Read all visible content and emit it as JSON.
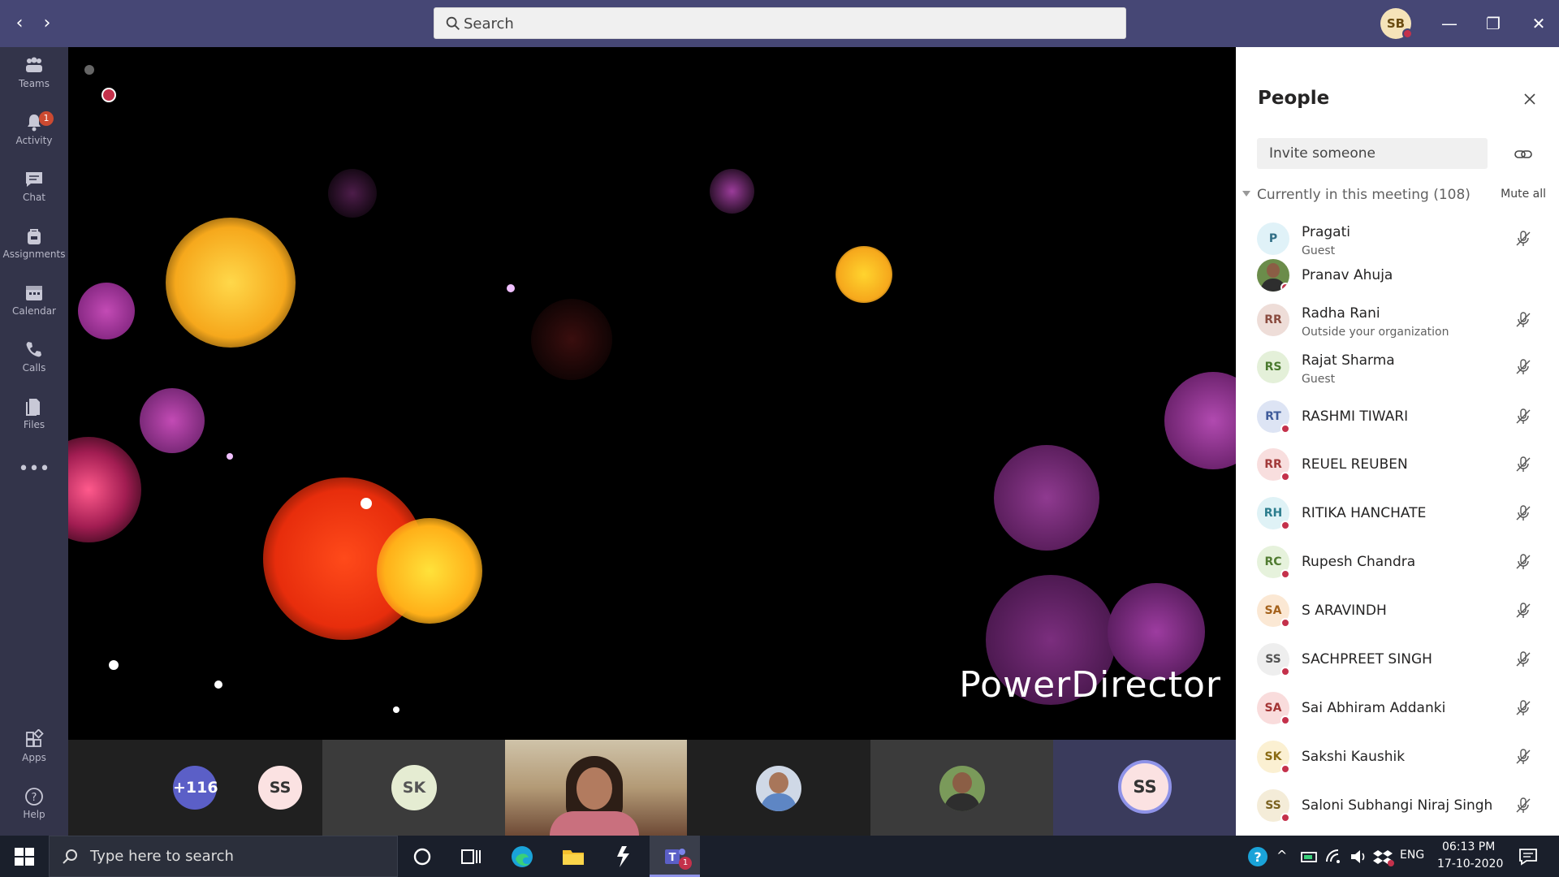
{
  "topbar": {
    "back_icon": "chevron-left-icon",
    "forward_icon": "chevron-right-icon",
    "search_placeholder": "Search",
    "user_initials": "SB",
    "minimize": "—",
    "maximize": "❐",
    "close": "✕"
  },
  "rail": {
    "items": [
      {
        "label": "Teams",
        "icon": "teams-icon"
      },
      {
        "label": "Activity",
        "icon": "bell-icon",
        "badge": "1"
      },
      {
        "label": "Chat",
        "icon": "chat-icon"
      },
      {
        "label": "Assignments",
        "icon": "backpack-icon"
      },
      {
        "label": "Calendar",
        "icon": "calendar-icon"
      },
      {
        "label": "Calls",
        "icon": "phone-icon"
      },
      {
        "label": "Files",
        "icon": "files-icon"
      },
      {
        "label": "•••",
        "icon": "more-icon"
      },
      {
        "label": "Apps",
        "icon": "apps-icon"
      },
      {
        "label": "Help",
        "icon": "help-icon"
      }
    ]
  },
  "stage": {
    "watermark": "PowerDirector",
    "recording_indicator": "recording-icon"
  },
  "gallery": {
    "overflow_count": "+116",
    "tiles": [
      {
        "initials": "SS"
      },
      {
        "initials": "SK"
      },
      {
        "initials": ""
      },
      {
        "initials": ""
      },
      {
        "initials": ""
      },
      {
        "initials": "SS"
      }
    ]
  },
  "panel": {
    "title": "People",
    "invite_placeholder": "Invite someone",
    "section_label": "Currently in this meeting (108)",
    "mute_all": "Mute all",
    "people": [
      {
        "initials": "P",
        "name": "Pragati",
        "sub": "Guest",
        "color": "#e0f2f8",
        "fg": "#2f6d85",
        "status": false,
        "mic": true
      },
      {
        "initials": "",
        "name": "Pranav Ahuja",
        "sub": "",
        "color": "#6b8c4a",
        "fg": "#fff",
        "status": true,
        "mic": false
      },
      {
        "initials": "RR",
        "name": "Radha Rani",
        "sub": "Outside your organization",
        "color": "#eeddd8",
        "fg": "#8a4b3f",
        "status": false,
        "mic": true
      },
      {
        "initials": "RS",
        "name": "Rajat Sharma",
        "sub": "Guest",
        "color": "#e4f0d9",
        "fg": "#4a7a2e",
        "status": false,
        "mic": true
      },
      {
        "initials": "RT",
        "name": "RASHMI TIWARI",
        "sub": "",
        "color": "#dde4f4",
        "fg": "#3f5b9a",
        "status": true,
        "mic": true
      },
      {
        "initials": "RR",
        "name": "REUEL REUBEN",
        "sub": "",
        "color": "#f8dede",
        "fg": "#a23a3a",
        "status": true,
        "mic": true
      },
      {
        "initials": "RH",
        "name": "RITIKA HANCHATE",
        "sub": "",
        "color": "#dff2f6",
        "fg": "#2c7d8e",
        "status": true,
        "mic": true
      },
      {
        "initials": "RC",
        "name": "Rupesh Chandra",
        "sub": "",
        "color": "#e6f2dc",
        "fg": "#517c32",
        "status": true,
        "mic": true
      },
      {
        "initials": "SA",
        "name": "S ARAVINDH",
        "sub": "",
        "color": "#fbe8d4",
        "fg": "#a5621c",
        "status": true,
        "mic": true
      },
      {
        "initials": "SS",
        "name": "SACHPREET SINGH",
        "sub": "",
        "color": "#eeeeee",
        "fg": "#555555",
        "status": true,
        "mic": true
      },
      {
        "initials": "SA",
        "name": "Sai Abhiram Addanki",
        "sub": "",
        "color": "#f9dcdc",
        "fg": "#a33434",
        "status": true,
        "mic": true
      },
      {
        "initials": "SK",
        "name": "Sakshi Kaushik",
        "sub": "",
        "color": "#fbf0d2",
        "fg": "#8a6a12",
        "status": true,
        "mic": true
      },
      {
        "initials": "SS",
        "name": "Saloni Subhangi Niraj Singh",
        "sub": "",
        "color": "#f4ecd8",
        "fg": "#7a6120",
        "status": true,
        "mic": true
      }
    ]
  },
  "taskbar": {
    "search_placeholder": "Type here to search",
    "language": "ENG",
    "time": "06:13 PM",
    "date": "17-10-2020",
    "teams_badge": "1"
  },
  "colors": {
    "topbar": "#464775",
    "rail": "#33344a",
    "accent_status": "#c4314b"
  }
}
